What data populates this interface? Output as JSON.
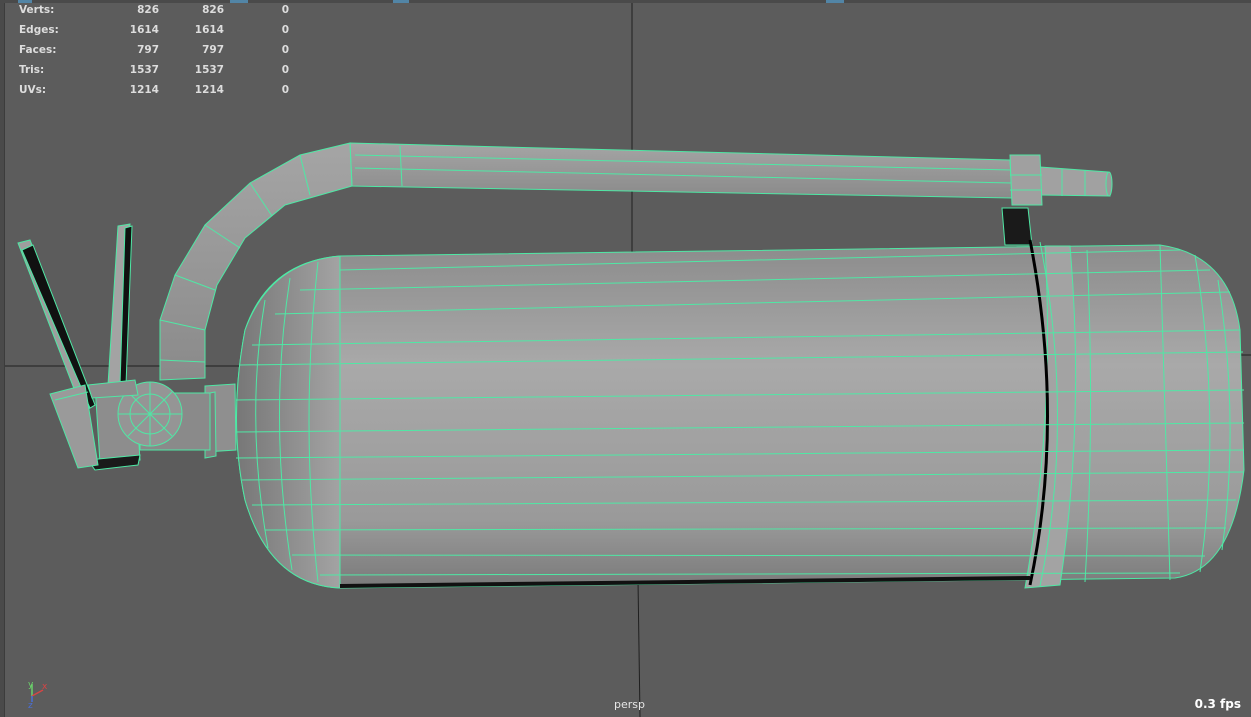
{
  "hud": {
    "rows": [
      {
        "label": "Verts:",
        "c1": "826",
        "c2": "826",
        "c3": "0"
      },
      {
        "label": "Edges:",
        "c1": "1614",
        "c2": "1614",
        "c3": "0"
      },
      {
        "label": "Faces:",
        "c1": "797",
        "c2": "797",
        "c3": "0"
      },
      {
        "label": "Tris:",
        "c1": "1537",
        "c2": "1537",
        "c3": "0"
      },
      {
        "label": "UVs:",
        "c1": "1214",
        "c2": "1214",
        "c3": "0"
      }
    ]
  },
  "viewport": {
    "camera": "persp",
    "fps": "0.3 fps",
    "background_color": "#5c5c5c",
    "grid_color": "#1f1f1f",
    "wireframe_color": "#4fe8a5",
    "axis_gizmo": {
      "x_label": "x",
      "y_label": "y",
      "z_label": "z"
    }
  },
  "model": {
    "name": "fire-extinguisher",
    "icons": [
      "hose-pipe",
      "tank-body",
      "squeeze-lever",
      "pressure-gauge",
      "mount-bracket",
      "nozzle"
    ]
  }
}
